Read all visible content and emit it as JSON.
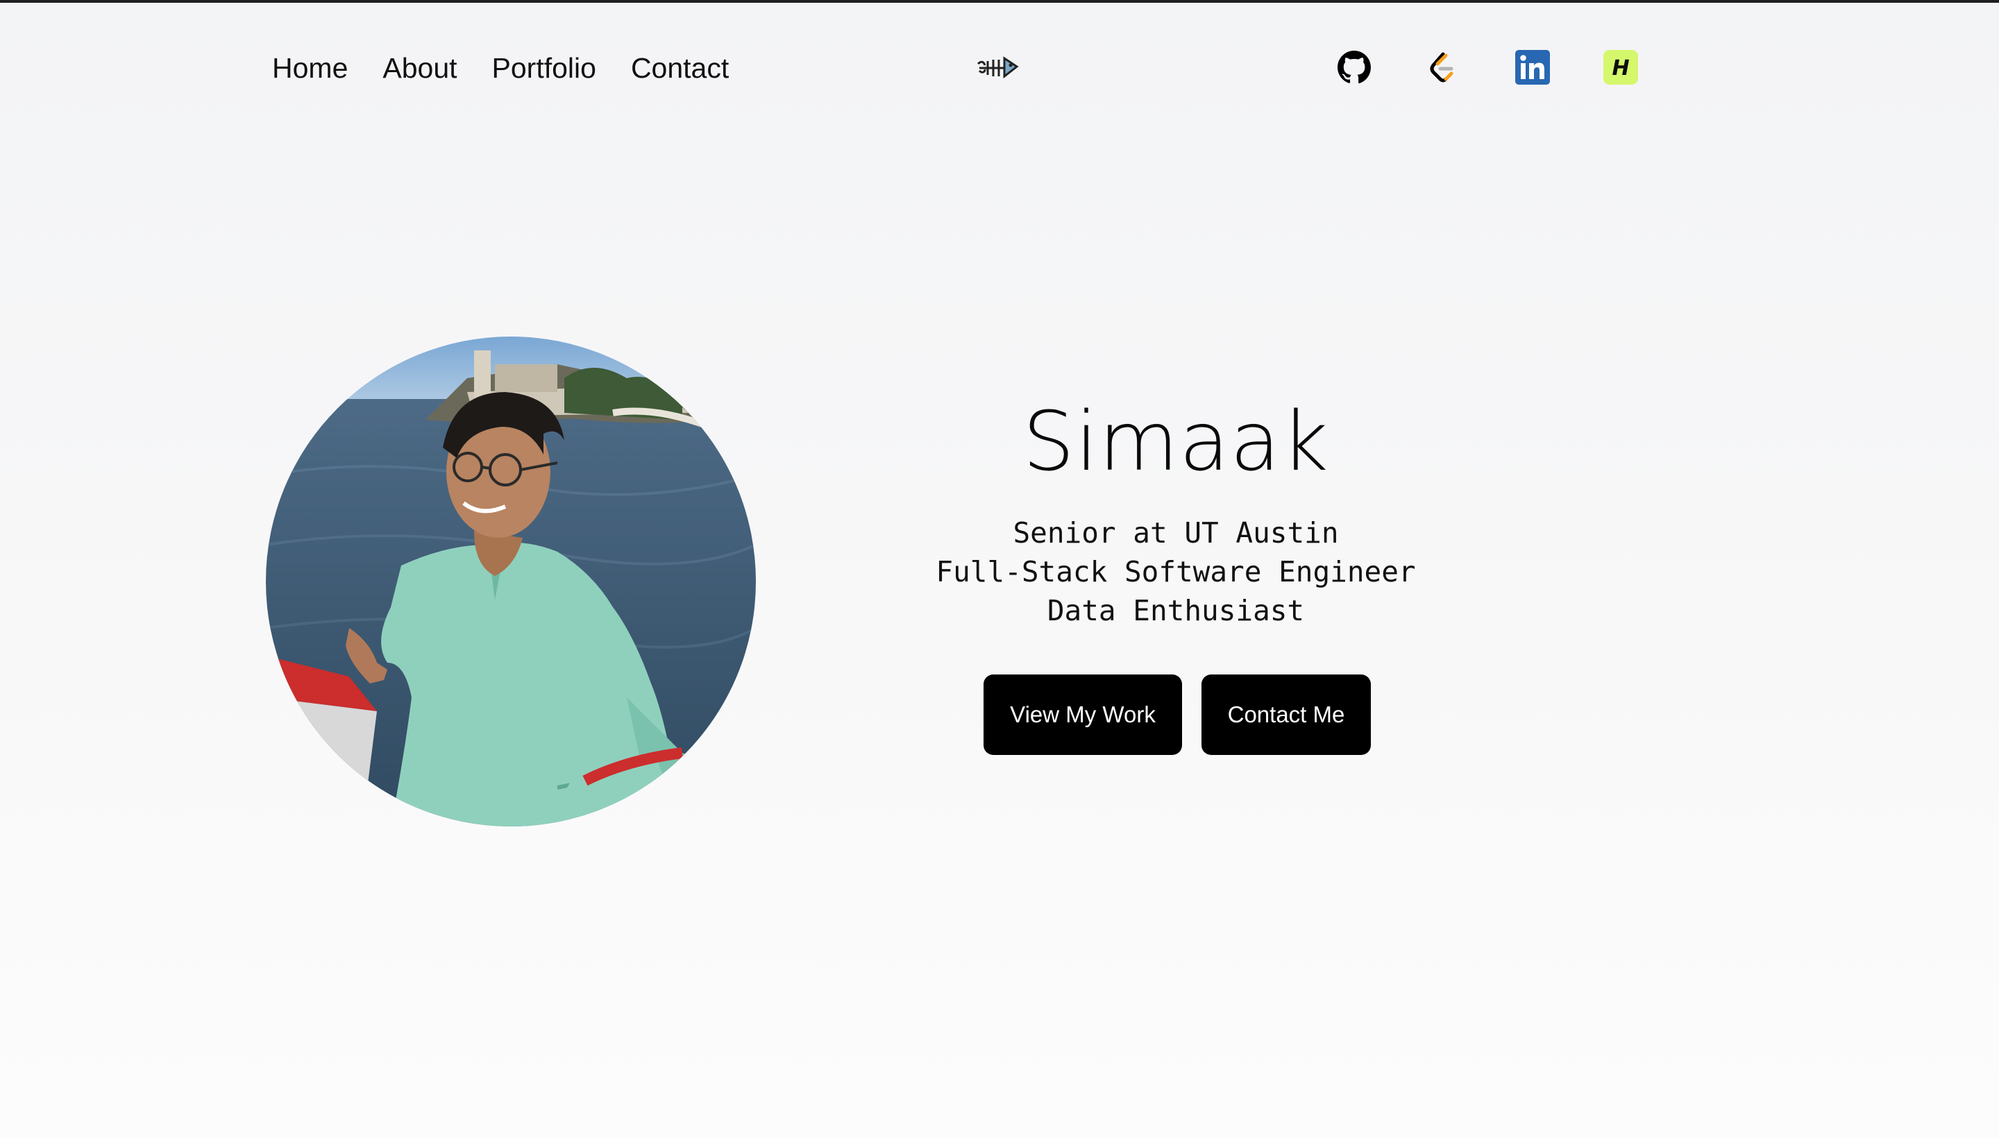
{
  "nav": {
    "links": [
      "Home",
      "About",
      "Portfolio",
      "Contact"
    ]
  },
  "logo": {
    "icon": "fishbone-logo"
  },
  "socials": [
    {
      "name": "github",
      "icon": "github-icon",
      "color": "#000000"
    },
    {
      "name": "leetcode",
      "icon": "leetcode-icon",
      "color": "#f89f1b"
    },
    {
      "name": "linkedin",
      "icon": "linkedin-icon",
      "color": "#2867b2"
    },
    {
      "name": "hackerrank",
      "icon": "hackerrank-icon",
      "color": "#d4f76b"
    }
  ],
  "hero": {
    "name": "Simaak",
    "lines": [
      "Senior at UT Austin",
      "Full-Stack Software Engineer",
      "Data Enthusiast"
    ],
    "primary_button": "View My Work",
    "secondary_button": "Contact Me"
  },
  "colors": {
    "accent": "#000000",
    "button_text": "#ffffff",
    "background": "#f5f5f6"
  }
}
